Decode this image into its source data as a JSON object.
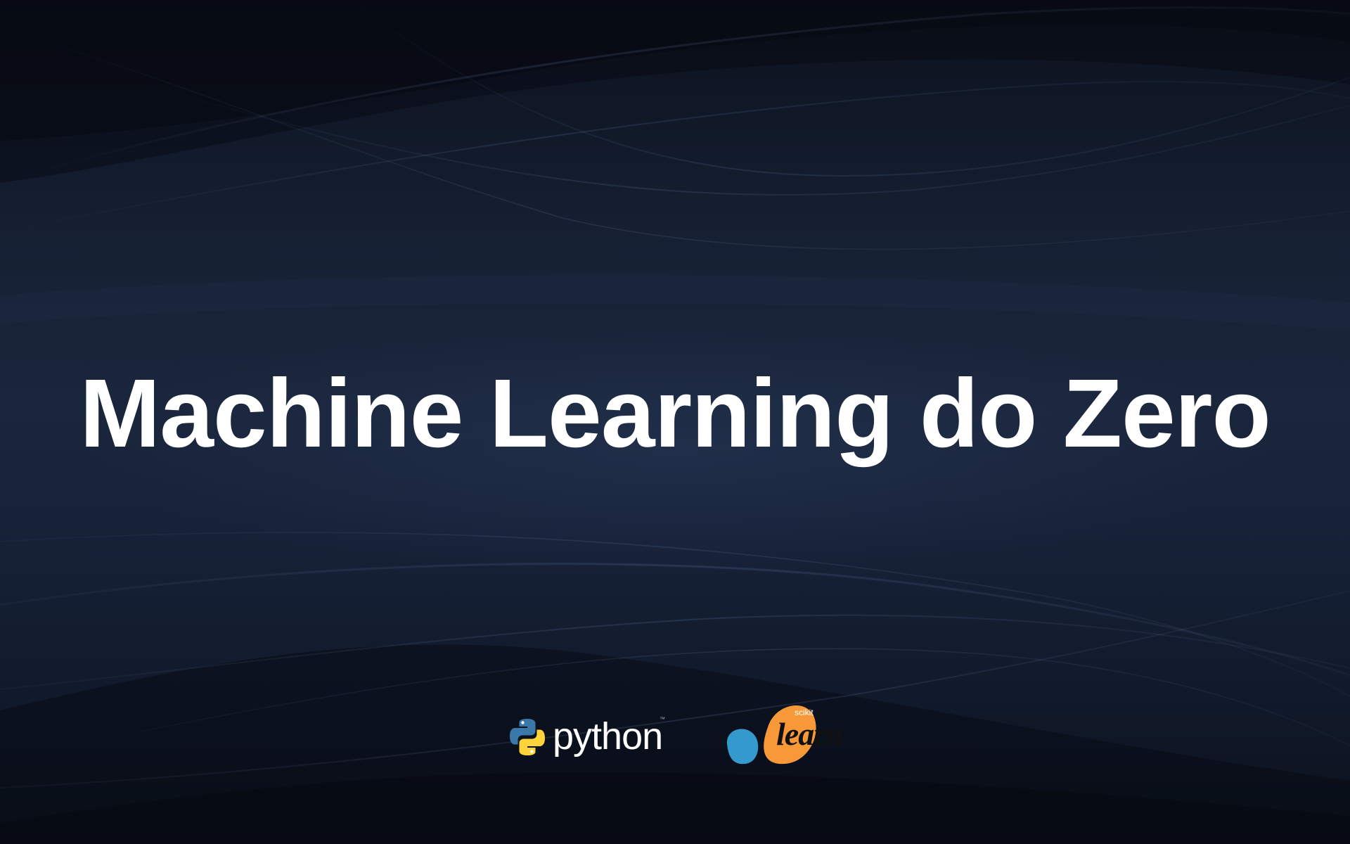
{
  "slide": {
    "title": "Machine Learning do Zero"
  },
  "logos": {
    "python": {
      "wordmark": "python",
      "trademark": "™",
      "colors": {
        "blue": "#3b77a8",
        "yellow": "#ffd43b"
      }
    },
    "scikit_learn": {
      "small_text": "scikit",
      "big_text": "learn",
      "colors": {
        "orange": "#f89939",
        "blue": "#3499cd"
      }
    }
  },
  "theme": {
    "background": "#0f1727",
    "title_color": "#ffffff"
  }
}
